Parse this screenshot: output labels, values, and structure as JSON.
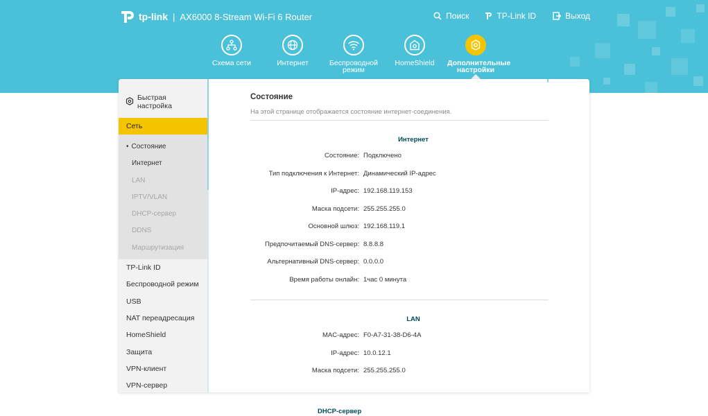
{
  "header": {
    "brand": "tp-link",
    "separator": "|",
    "model": "AX6000 8-Stream Wi-Fi 6 Router",
    "actions": [
      {
        "label": "Поиск",
        "icon": "search-icon"
      },
      {
        "label": "TP-Link ID",
        "icon": "tplink-id-icon"
      },
      {
        "label": "Выход",
        "icon": "logout-icon"
      }
    ]
  },
  "nav": [
    {
      "label": "Схема сети",
      "icon": "network-map-icon"
    },
    {
      "label": "Интернет",
      "icon": "globe-icon"
    },
    {
      "label": "Беспроводной режим",
      "icon": "wifi-icon"
    },
    {
      "label": "HomeShield",
      "icon": "homeshield-icon"
    },
    {
      "label": "Дополнительные настройки",
      "icon": "advanced-gear-icon",
      "active": true
    }
  ],
  "sidebar": {
    "quick_setup": "Быстрая настройка",
    "network": "Сеть",
    "network_sub": [
      "Состояние",
      "Интернет",
      "LAN",
      "IPTV/VLAN",
      "DHCP-сервер",
      "DDNS",
      "Маршрутизация"
    ],
    "items": [
      "TP-Link ID",
      "Беспроводной режим",
      "USB",
      "NAT переадресация",
      "HomeShield",
      "Защита",
      "VPN-клиент",
      "VPN-сервер"
    ]
  },
  "main": {
    "title": "Состояние",
    "description": "На этой странице отображается состояние интернет-соединения.",
    "internet": {
      "title": "Интернет",
      "rows": [
        {
          "label": "Состояние:",
          "value": "Подключено"
        },
        {
          "label": "Тип подключения к Интернет:",
          "value": "Динамический IP-адрес"
        },
        {
          "label": "IP-адрес:",
          "value": "192.168.119.153"
        },
        {
          "label": "Маска подсети:",
          "value": "255.255.255.0"
        },
        {
          "label": "Основной шлюз:",
          "value": "192.168.119.1"
        },
        {
          "label": "Предпочитаемый DNS-сервер:",
          "value": "8.8.8.8"
        },
        {
          "label": "Альтернативный DNS-сервер:",
          "value": "0.0.0.0"
        },
        {
          "label": "Время работы онлайн:",
          "value": "1час 0 минута"
        }
      ]
    },
    "lan": {
      "title": "LAN",
      "rows": [
        {
          "label": "MAC-адрес:",
          "value": "F0-A7-31-38-D6-4A"
        },
        {
          "label": "IP-адрес:",
          "value": "10.0.12.1"
        },
        {
          "label": "Маска подсети:",
          "value": "255.255.255.0"
        }
      ]
    },
    "dhcp_title": "DHCP-сервер"
  },
  "colors": {
    "header_bg": "#4bc1d9",
    "accent": "#f5c400",
    "section_title": "#004b5a"
  }
}
